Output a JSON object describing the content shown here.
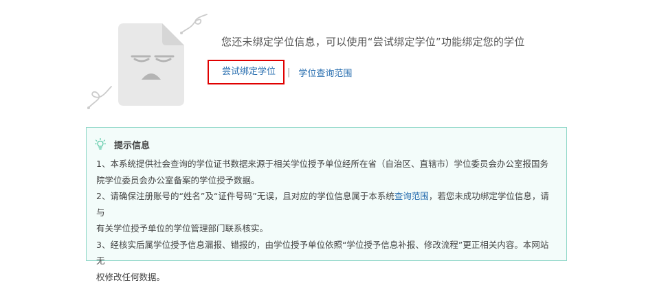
{
  "empty_state": {
    "message": "您还未绑定学位信息，可以使用“尝试绑定学位”功能绑定您的学位",
    "try_bind_link": "尝试绑定学位",
    "separator": "|",
    "query_scope_link": "学位查询范围",
    "illustration_icon": "sad-document-icon"
  },
  "tips": {
    "icon": "lightbulb-icon",
    "title": "提示信息",
    "item1_line1": "1、本系统提供社会查询的学位证书数据来源于相关学位授予单位经所在省（自治区、直辖市）学位委员会办公室报国务",
    "item1_line2": "院学位委员会办公室备案的学位授予数据。",
    "item2_line1_before": "2、请确保注册账号的“姓名”及“证件号码”无误，且对应的学位信息属于本系统",
    "item2_link": "查询范围",
    "item2_line1_after": "，若您未成功绑定学位信息，请与",
    "item2_line2": "有关学位授予单位的学位管理部门联系核实。",
    "item3_line1": "3、经核实后属学位授予信息漏报、错报的，由学位授予单位依照“学位授予信息补报、修改流程”更正相关内容。本网站无",
    "item3_line2": "权修改任何数据。"
  },
  "colors": {
    "link": "#2a6fb0",
    "highlight_border": "#e00000",
    "tips_border": "#8fd7c8",
    "tips_background": "#f3fcfa",
    "bulb": "#5cc9a7"
  }
}
